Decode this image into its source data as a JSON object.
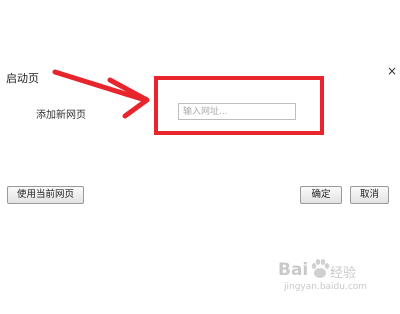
{
  "dialog": {
    "title": "启动页",
    "close_symbol": "×"
  },
  "form": {
    "add_page_label": "添加新网页",
    "url_input_placeholder": "输入网址...",
    "url_input_value": ""
  },
  "buttons": {
    "use_current_label": "使用当前网页",
    "ok_label": "确定",
    "cancel_label": "取消"
  },
  "annotation": {
    "color": "#e8252c",
    "arrow_icon": "arrow-right-icon"
  },
  "watermark": {
    "brand_bai": "Bai",
    "brand_jingyan": "经验",
    "url": "jingyan.baidu.com"
  }
}
